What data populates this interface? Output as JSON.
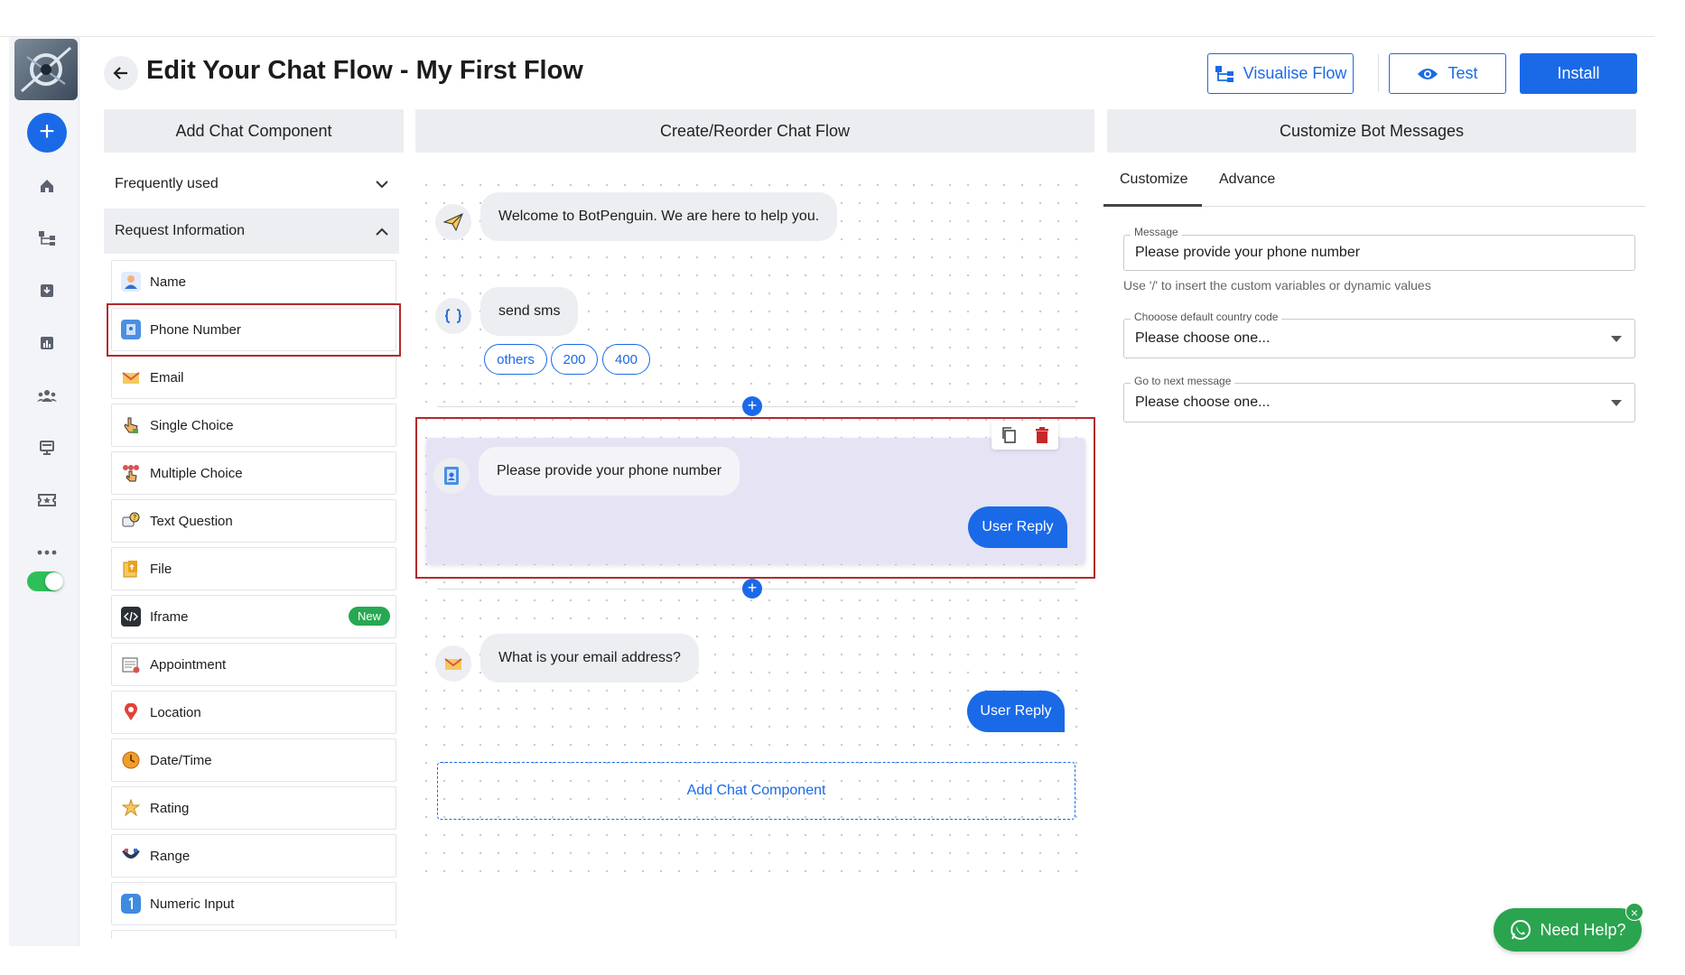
{
  "header": {
    "title": "Edit Your Chat Flow - My First Flow",
    "visualise_label": "Visualise Flow",
    "test_label": "Test",
    "install_label": "Install"
  },
  "panels": {
    "left": "Add Chat Component",
    "center": "Create/Reorder Chat Flow",
    "right": "Customize Bot Messages"
  },
  "left_panel": {
    "sections": [
      "Frequently used",
      "Request Information"
    ],
    "components": [
      {
        "label": "Name",
        "icon": "person-icon"
      },
      {
        "label": "Phone Number",
        "icon": "phone-book-icon"
      },
      {
        "label": "Email",
        "icon": "envelope-icon"
      },
      {
        "label": "Single Choice",
        "icon": "hand-pointer-icon"
      },
      {
        "label": "Multiple Choice",
        "icon": "multi-choice-icon"
      },
      {
        "label": "Text Question",
        "icon": "question-bubble-icon"
      },
      {
        "label": "File",
        "icon": "file-icon"
      },
      {
        "label": "Iframe",
        "icon": "code-icon",
        "badge": "New"
      },
      {
        "label": "Appointment",
        "icon": "calendar-icon"
      },
      {
        "label": "Location",
        "icon": "location-pin-icon"
      },
      {
        "label": "Date/Time",
        "icon": "clock-icon"
      },
      {
        "label": "Rating",
        "icon": "star-burst-icon"
      },
      {
        "label": "Range",
        "icon": "range-icon"
      },
      {
        "label": "Numeric Input",
        "icon": "number-one-icon"
      }
    ]
  },
  "flow": {
    "welcome": "Welcome to BotPenguin. We are here to help you.",
    "api_label": "send sms",
    "chips": [
      "others",
      "200",
      "400"
    ],
    "phone_message": "Please provide your phone number",
    "user_reply": "User Reply",
    "email_message": "What is your email address?",
    "add_component": "Add Chat Component"
  },
  "customize": {
    "tabs": [
      "Customize",
      "Advance"
    ],
    "message_label": "Message",
    "message_value": "Please provide your phone number",
    "hint": "Use '/' to insert the custom variables or dynamic values",
    "country_label": "Chooose default country code",
    "country_value": "Please choose one...",
    "next_label": "Go to next message",
    "next_value": "Please choose one..."
  },
  "help": {
    "label": "Need Help?",
    "close": "×"
  },
  "colors": {
    "accent": "#1a6ae8",
    "highlight": "#b32a2a",
    "whatsapp": "#2aa44f"
  }
}
